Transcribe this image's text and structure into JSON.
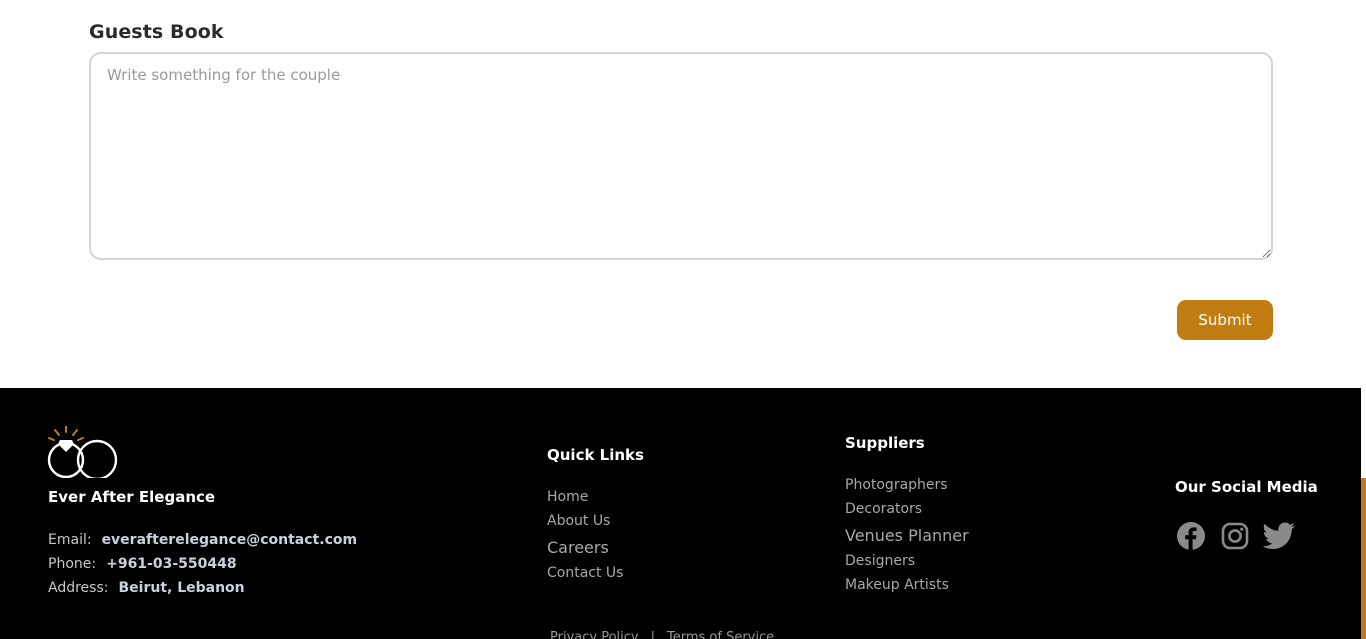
{
  "guestbook": {
    "title": "Guests Book",
    "placeholder": "Write something for the couple",
    "value": "",
    "submit_label": "Submit"
  },
  "colors": {
    "accent": "#c27d12",
    "footer_bg": "#000000",
    "link": "#a8a8a8",
    "contact_value": "#c9d0de"
  },
  "footer": {
    "brand": {
      "name": "Ever After Elegance",
      "logo_icon": "wedding-rings-icon"
    },
    "contact": {
      "email_label": "Email:",
      "email": "everafterelegance@contact.com",
      "phone_label": "Phone:",
      "phone": "+961-03-550448",
      "address_label": "Address:",
      "address": "Beirut, Lebanon"
    },
    "quick_links": {
      "heading": "Quick Links",
      "items": [
        "Home",
        "About Us",
        "Careers",
        "Contact Us"
      ]
    },
    "suppliers": {
      "heading": "Suppliers",
      "items": [
        "Photographers",
        "Decorators",
        "Venues Planner",
        "Designers",
        "Makeup Artists"
      ]
    },
    "social": {
      "heading": "Our Social Media",
      "icons": [
        "facebook-icon",
        "instagram-icon",
        "twitter-icon"
      ]
    },
    "legal": {
      "privacy": "Privacy Policy",
      "separator": "|",
      "terms": "Terms of Service"
    }
  }
}
